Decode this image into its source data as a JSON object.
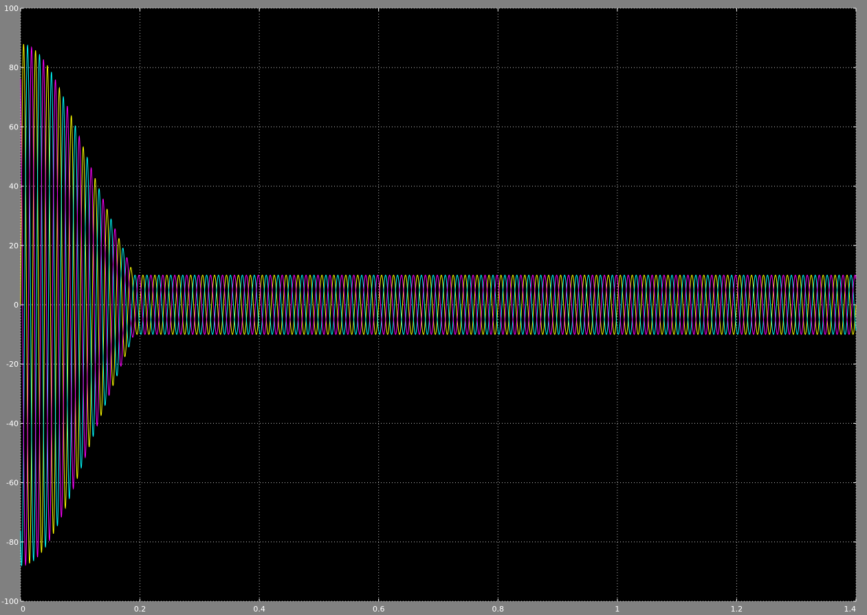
{
  "chart_data": {
    "type": "line",
    "title": "",
    "xlabel": "",
    "ylabel": "",
    "xlim": [
      0,
      1.4
    ],
    "ylim": [
      -100,
      100
    ],
    "grid": true,
    "legend": "none",
    "x_ticks": [
      "0",
      "0.2",
      "0.4",
      "0.6",
      "0.8",
      "1",
      "1.2",
      "1.4"
    ],
    "y_ticks": [
      "100",
      "80",
      "60",
      "40",
      "20",
      "0",
      "-20",
      "-40",
      "-60",
      "-80",
      "-100"
    ],
    "colors": {
      "background": "#000000",
      "frame": "#808080",
      "grid": "#ffffff",
      "text": "#ffffff"
    },
    "waveform": {
      "frequency_hz": 50,
      "phase_shift_deg": 120,
      "transient_peak": 88,
      "transient_end_time": 0.19,
      "steady_amplitude": 10
    },
    "series": [
      {
        "color": "#ffff00",
        "phase_deg": 0
      },
      {
        "color": "#00ffff",
        "phase_deg": -120
      },
      {
        "color": "#ff00ff",
        "phase_deg": 120
      }
    ]
  }
}
